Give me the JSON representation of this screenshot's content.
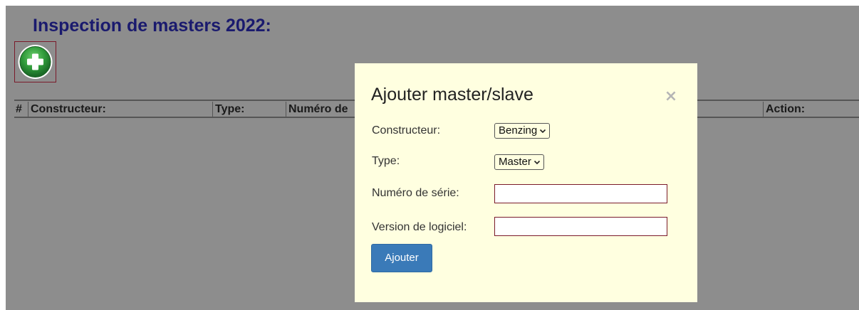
{
  "page": {
    "title": "Inspection de masters 2022:"
  },
  "table": {
    "headers": [
      "#",
      "Constructeur:",
      "Type:",
      "Numéro de",
      "Action:"
    ]
  },
  "modal": {
    "title": "Ajouter master/slave",
    "close_label": "×",
    "fields": {
      "constructeur": {
        "label": "Constructeur:",
        "value": "Benzing"
      },
      "type": {
        "label": "Type:",
        "value": "Master"
      },
      "serie": {
        "label": "Numéro de série:",
        "value": "",
        "placeholder": ""
      },
      "logiciel": {
        "label": "Version de logiciel:",
        "value": "",
        "placeholder": ""
      }
    },
    "submit_label": "Ajouter"
  },
  "icons": {
    "add": "plus-circle-icon",
    "close": "close-icon",
    "dropdown": "chevron-down-icon"
  },
  "colors": {
    "backdrop": "#8d8d8d",
    "title": "#1a1a6e",
    "modal_bg": "#ffffe0",
    "submit_bg": "#3a7ab8",
    "add_icon": "#2e8b3a"
  }
}
